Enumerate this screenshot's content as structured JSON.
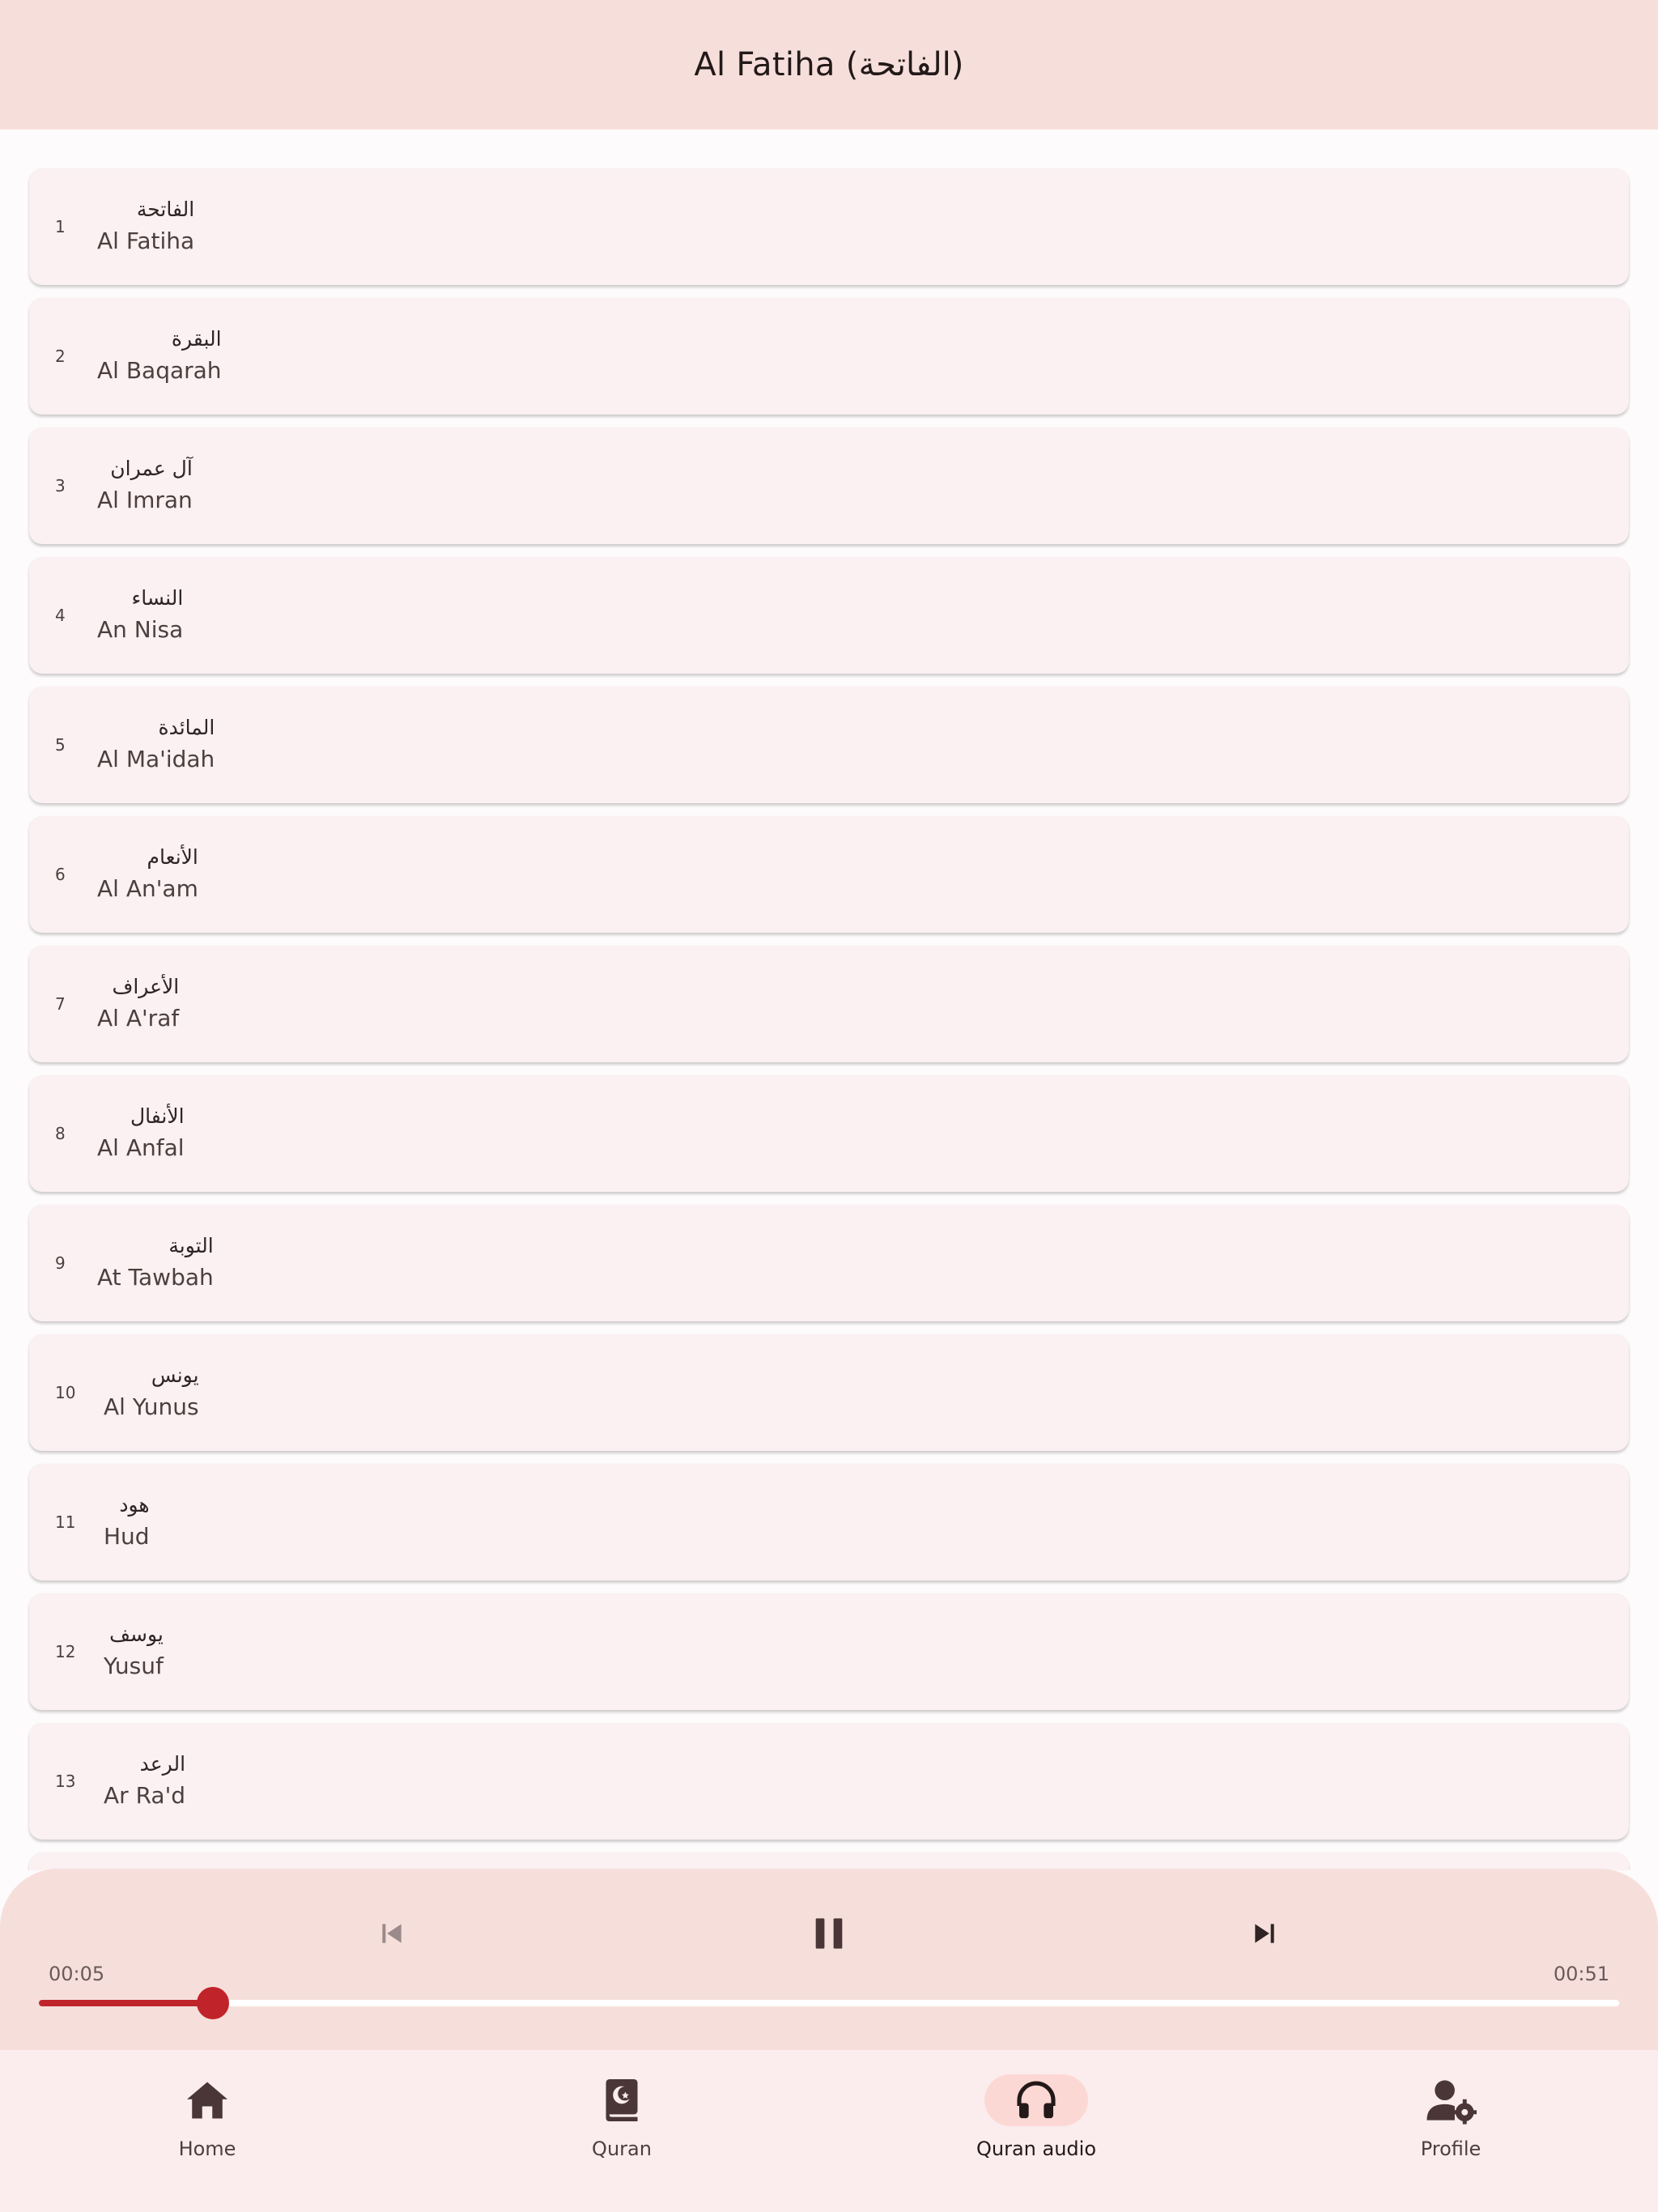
{
  "app_bar": {
    "title": "Al Fatiha (الفاتحة)"
  },
  "surahs": [
    {
      "number": "1",
      "arabic": "الفاتحة",
      "name": "Al Fatiha"
    },
    {
      "number": "2",
      "arabic": "البقرة",
      "name": "Al Baqarah"
    },
    {
      "number": "3",
      "arabic": "آل عمران",
      "name": "Al Imran"
    },
    {
      "number": "4",
      "arabic": "النساء",
      "name": "An Nisa"
    },
    {
      "number": "5",
      "arabic": "المائدة",
      "name": "Al Ma'idah"
    },
    {
      "number": "6",
      "arabic": "الأنعام",
      "name": "Al An'am"
    },
    {
      "number": "7",
      "arabic": "الأعراف",
      "name": "Al A'raf"
    },
    {
      "number": "8",
      "arabic": "الأنفال",
      "name": "Al Anfal"
    },
    {
      "number": "9",
      "arabic": "التوبة",
      "name": "At Tawbah"
    },
    {
      "number": "10",
      "arabic": "يونس",
      "name": "Al Yunus"
    },
    {
      "number": "11",
      "arabic": "هود",
      "name": "Hud"
    },
    {
      "number": "12",
      "arabic": "يوسف",
      "name": "Yusuf"
    },
    {
      "number": "13",
      "arabic": "الرعد",
      "name": "Ar Ra'd"
    }
  ],
  "player": {
    "elapsed": "00:05",
    "duration": "00:51",
    "progress": 0.11,
    "state": "playing",
    "controls": [
      "skip-previous-icon",
      "pause-icon",
      "skip-next-icon"
    ],
    "accent_color": "#c0242a"
  },
  "bottom_nav": {
    "items": [
      {
        "label": "Home",
        "icon": "home-icon"
      },
      {
        "label": "Quran",
        "icon": "quran-book-icon"
      },
      {
        "label": "Quran audio",
        "icon": "headphones-icon",
        "active": true
      },
      {
        "label": "Profile",
        "icon": "profile-settings-icon"
      }
    ]
  },
  "colors": {
    "app_bar": "#f6dfdb",
    "card": "#fbf0f2",
    "active_indicator": "#fcd8d4"
  }
}
